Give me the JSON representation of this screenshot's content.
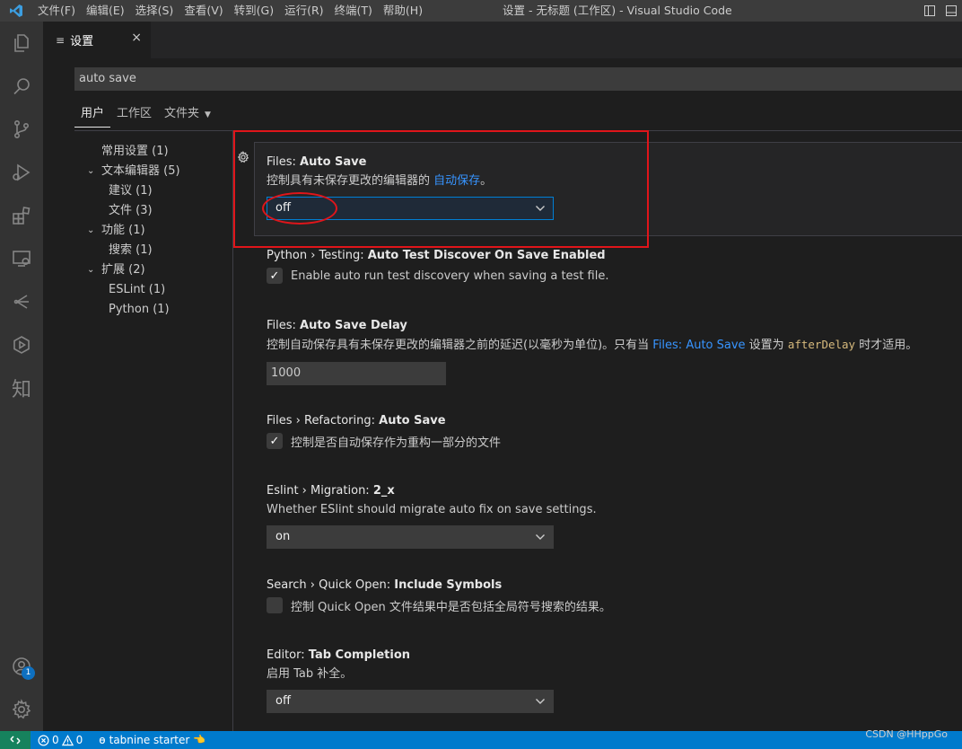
{
  "window": {
    "title": "设置 - 无标题 (工作区) - Visual Studio Code",
    "menu": [
      "文件(F)",
      "编辑(E)",
      "选择(S)",
      "查看(V)",
      "转到(G)",
      "运行(R)",
      "终端(T)",
      "帮助(H)"
    ]
  },
  "activity_bar": {
    "items": [
      "files-icon",
      "search-icon",
      "source-control-icon",
      "run-debug-icon",
      "extensions-icon",
      "remote-explorer-icon",
      "git-lens-icon",
      "sourcery-icon",
      "zhihu-icon"
    ],
    "zhihu_glyph": "知",
    "accounts_badge": "1"
  },
  "tab": {
    "label": "设置",
    "icon": "≡",
    "close": "×"
  },
  "search": {
    "value": "auto save"
  },
  "scopes": {
    "user": "用户",
    "workspace": "工作区",
    "folder": "文件夹"
  },
  "toc": [
    {
      "label": "常用设置 (1)",
      "level": 0,
      "chevron": ""
    },
    {
      "label": "文本编辑器 (5)",
      "level": 0,
      "chevron": "⌄"
    },
    {
      "label": "建议 (1)",
      "level": 1,
      "chevron": ""
    },
    {
      "label": "文件 (3)",
      "level": 1,
      "chevron": ""
    },
    {
      "label": "功能 (1)",
      "level": 0,
      "chevron": "⌄"
    },
    {
      "label": "搜索 (1)",
      "level": 1,
      "chevron": ""
    },
    {
      "label": "扩展 (2)",
      "level": 0,
      "chevron": "⌄"
    },
    {
      "label": "ESLint (1)",
      "level": 1,
      "chevron": ""
    },
    {
      "label": "Python (1)",
      "level": 1,
      "chevron": ""
    }
  ],
  "settings": {
    "auto_save": {
      "category": "Files: ",
      "key": "Auto Save",
      "desc_prefix": "控制具有未保存更改的编辑器的 ",
      "desc_link": "自动保存",
      "desc_suffix": "。",
      "value": "off"
    },
    "python_testing": {
      "category": "Python › Testing: ",
      "key": "Auto Test Discover On Save Enabled",
      "checkbox_label": "Enable auto run test discovery when saving a test file.",
      "checked": true
    },
    "auto_save_delay": {
      "category": "Files: ",
      "key": "Auto Save Delay",
      "desc_prefix": "控制自动保存具有未保存更改的编辑器之前的延迟(以毫秒为单位)。只有当 ",
      "desc_link": "Files: Auto Save",
      "desc_mid": " 设置为 ",
      "desc_code": "afterDelay",
      "desc_suffix": " 时才适用。",
      "value": "1000"
    },
    "refactoring": {
      "category": "Files › Refactoring: ",
      "key": "Auto Save",
      "checkbox_label": "控制是否自动保存作为重构一部分的文件",
      "checked": true
    },
    "eslint": {
      "category": "Eslint › Migration: ",
      "key": "2_x",
      "desc": "Whether ESlint should migrate auto fix on save settings.",
      "value": "on"
    },
    "quick_open": {
      "category": "Search › Quick Open: ",
      "key": "Include Symbols",
      "checkbox_label": "控制 Quick Open 文件结果中是否包括全局符号搜索的结果。",
      "checked": false
    },
    "tab_completion": {
      "category": "Editor: ",
      "key": "Tab Completion",
      "desc": "启用 Tab 补全。",
      "value": "off"
    }
  },
  "statusbar": {
    "errors": "0",
    "warnings": "0",
    "tabnine": "tabnine starter",
    "tabnine_glyph": "ɵ",
    "hand_emoji": "👈"
  },
  "watermark": "CSDN @HHppGo",
  "colors": {
    "accent": "#007acc",
    "link": "#3794ff",
    "highlight": "#e0151a"
  }
}
